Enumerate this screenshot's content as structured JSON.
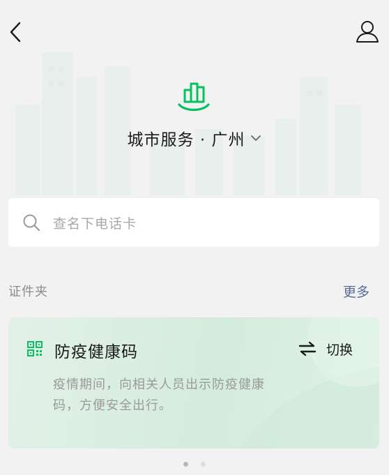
{
  "nav": {
    "back_icon": "chevron-left-icon",
    "profile_icon": "user-icon"
  },
  "header": {
    "logo_icon": "city-buildings-icon",
    "title": "城市服务 · 广州",
    "dropdown_icon": "chevron-down-icon"
  },
  "search": {
    "icon": "search-icon",
    "placeholder": "查名下电话卡"
  },
  "wallet": {
    "title": "证件夹",
    "more_label": "更多"
  },
  "card": {
    "icon": "qr-code-icon",
    "title": "防疫健康码",
    "switch_icon": "swap-arrows-icon",
    "switch_label": "切换",
    "desc_line1": "疫情期间，向相关人员出示防疫健康",
    "desc_line2": "码，方便安全出行。"
  },
  "pager": {
    "count": 2,
    "active": 1
  },
  "colors": {
    "accent_green": "#07c160",
    "link_blue": "#576b95",
    "background": "#f2f2f2",
    "card_green": "#d4ecdc"
  }
}
